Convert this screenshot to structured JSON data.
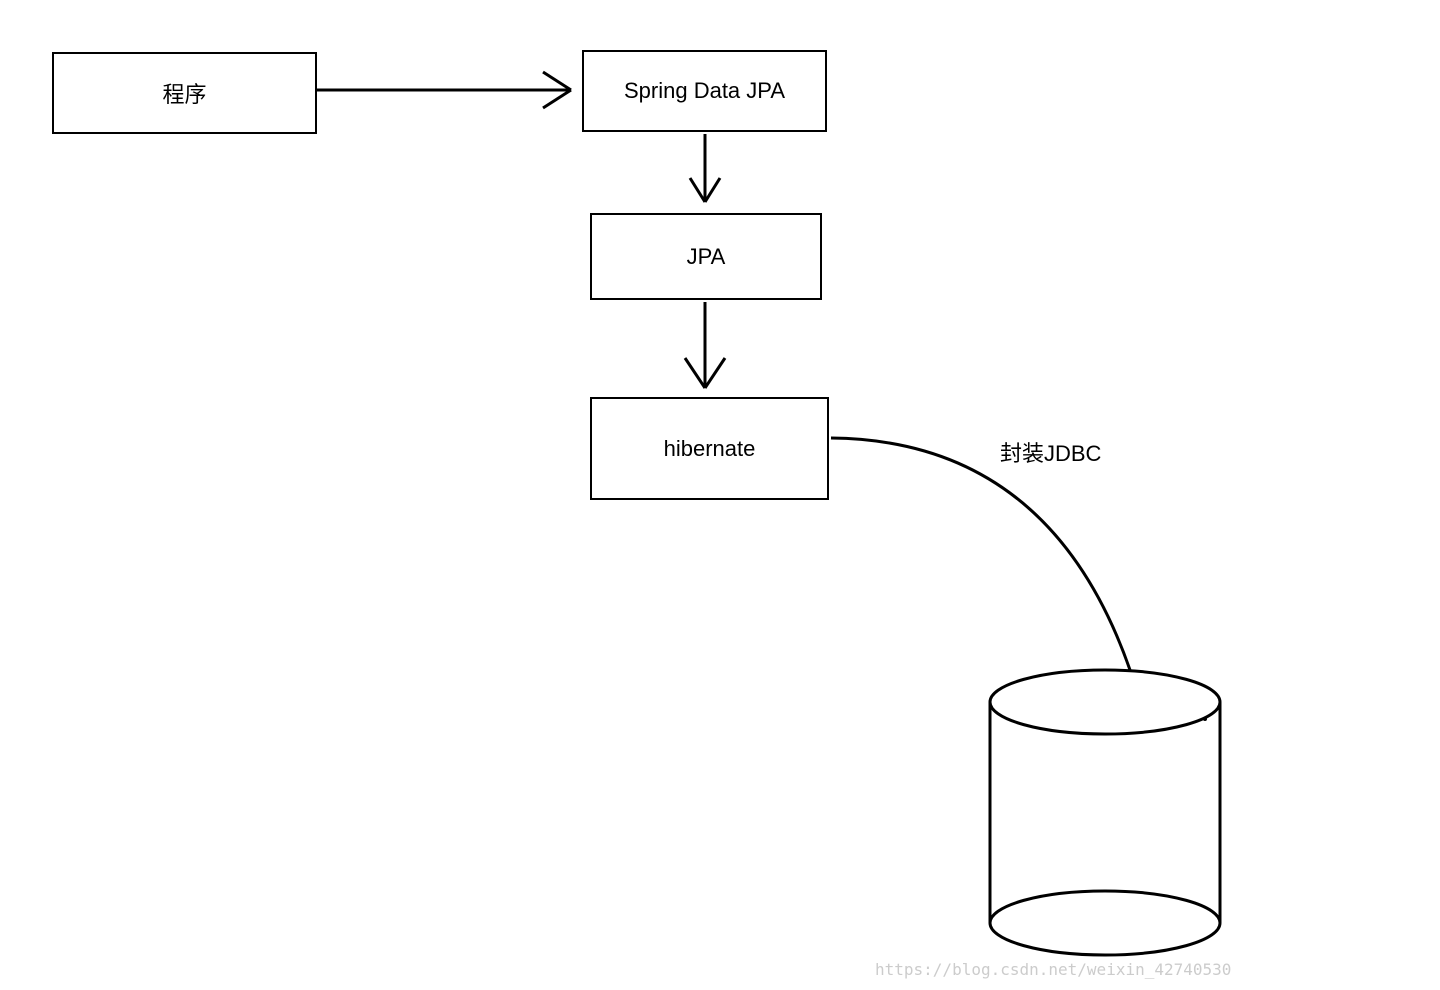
{
  "diagram": {
    "boxes": {
      "program": {
        "label": "程序"
      },
      "spring_data_jpa": {
        "label": "Spring Data JPA"
      },
      "jpa": {
        "label": "JPA"
      },
      "hibernate": {
        "label": "hibernate"
      }
    },
    "annotations": {
      "jdbc": {
        "label": "封装JDBC"
      }
    },
    "watermark": "https://blog.csdn.net/weixin_42740530"
  }
}
